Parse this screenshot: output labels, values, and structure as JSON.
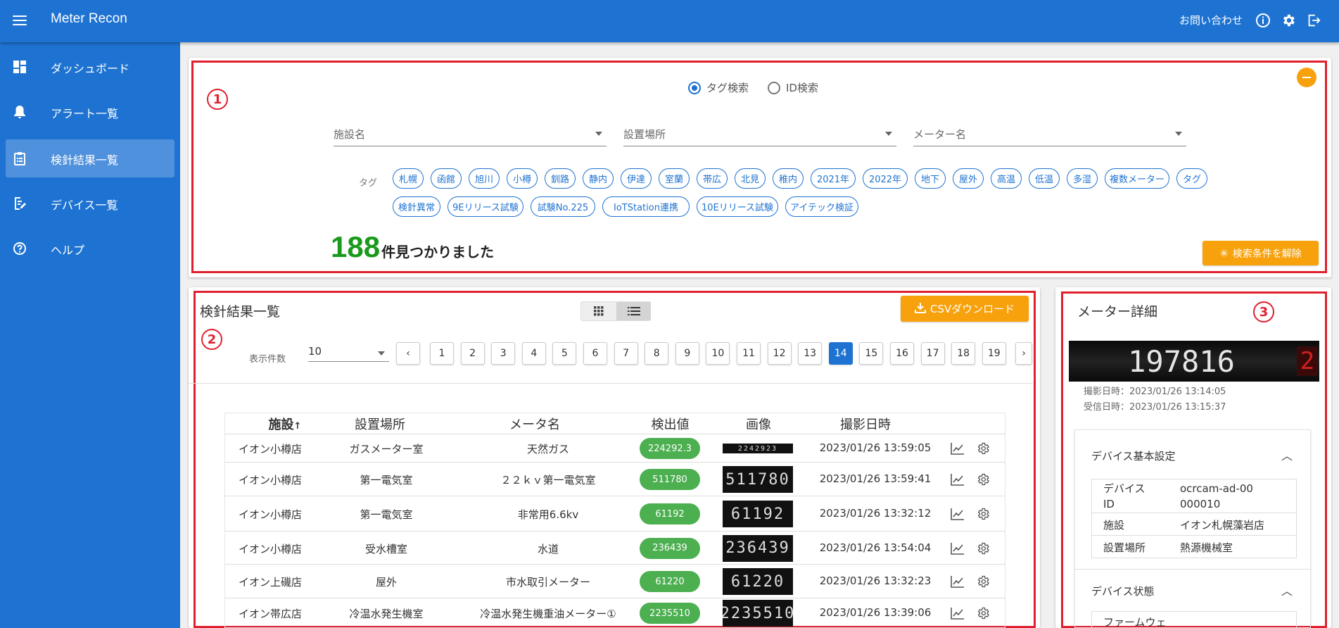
{
  "app": {
    "title": "Meter Recon",
    "contact": "お問い合わせ"
  },
  "sidebar": {
    "items": [
      {
        "label": "ダッシュボード",
        "icon": "dashboard-icon"
      },
      {
        "label": "アラート一覧",
        "icon": "bell-icon"
      },
      {
        "label": "検針結果一覧",
        "icon": "clipboard-icon",
        "active": true
      },
      {
        "label": "デバイス一覧",
        "icon": "edit-document-icon"
      },
      {
        "label": "ヘルプ",
        "icon": "help-icon"
      }
    ]
  },
  "annotations": {
    "one": "1",
    "two": "2",
    "three": "3"
  },
  "search": {
    "mode_tag": "タグ検索",
    "mode_id": "ID検索",
    "facility_placeholder": "施設名",
    "location_placeholder": "設置場所",
    "meter_placeholder": "メーター名",
    "tag_label": "タグ",
    "tags_row1": [
      "札幌",
      "函館",
      "旭川",
      "小樽",
      "釧路",
      "静内",
      "伊達",
      "室蘭",
      "帯広",
      "北見",
      "稚内",
      "2021年",
      "2022年",
      "地下",
      "屋外",
      "高温",
      "低温",
      "多湿",
      "複数メーター",
      "タグ"
    ],
    "tags_row2": [
      "検針異常",
      "9Eリリース試験",
      "試験No.225",
      "IoTStation連携",
      "10Eリリース試験",
      "アイテック検証"
    ],
    "count": "188",
    "count_suffix": "件見つかりました",
    "clear_button": "検索条件を解除"
  },
  "results": {
    "title": "検針結果一覧",
    "csv_button": "CSVダウンロード",
    "per_page_label": "表示件数",
    "per_page_value": "10",
    "pages": [
      "1",
      "2",
      "3",
      "4",
      "5",
      "6",
      "7",
      "8",
      "9",
      "10",
      "11",
      "12",
      "13",
      "14",
      "15",
      "16",
      "17",
      "18",
      "19"
    ],
    "current_page": "14",
    "headers": {
      "facility": "施設",
      "sort_arrow": "↑",
      "location": "設置場所",
      "meter": "メータ名",
      "value": "検出値",
      "image": "画像",
      "datetime": "撮影日時"
    },
    "rows": [
      {
        "facility": "イオン小樽店",
        "location": "ガスメーター室",
        "meter": "天然ガス",
        "value": "224292.3",
        "datetime": "2023/01/26 13:59:05"
      },
      {
        "facility": "イオン小樽店",
        "location": "第一電気室",
        "meter": "２２ｋｖ第一電気室",
        "value": "511780",
        "datetime": "2023/01/26 13:59:41"
      },
      {
        "facility": "イオン小樽店",
        "location": "第一電気室",
        "meter": "非常用6.6kv",
        "value": "61192",
        "datetime": "2023/01/26 13:32:12"
      },
      {
        "facility": "イオン小樽店",
        "location": "受水槽室",
        "meter": "水道",
        "value": "236439",
        "datetime": "2023/01/26 13:54:04"
      },
      {
        "facility": "イオン上磯店",
        "location": "屋外",
        "meter": "市水取引メーター",
        "value": "61220",
        "datetime": "2023/01/26 13:32:23"
      },
      {
        "facility": "イオン帯広店",
        "location": "冷温水発生機室",
        "meter": "冷温水発生機重油メーター①",
        "value": "2235510",
        "datetime": "2023/01/26 13:39:06"
      }
    ]
  },
  "detail": {
    "title": "メーター詳細",
    "image_digits": "197816",
    "image_digit_red": "2",
    "shot": "撮影日時：2023/01/26 13:14:05",
    "received": "受信日時：2023/01/26 13:15:37",
    "basic_title": "デバイス基本設定",
    "basic": [
      {
        "k": "デバイスID",
        "v": "ocrcam-ad-00000010"
      },
      {
        "k": "施設",
        "v": "イオン札幌藻岩店"
      },
      {
        "k": "設置場所",
        "v": "熱源機械室"
      }
    ],
    "status_title": "デバイス状態",
    "status_first": "ファームウェ"
  },
  "colors": {
    "primary": "#1e73d2",
    "accent": "#f7a10c",
    "annotation": "#e0202f",
    "count": "#1a9a1a",
    "pill": "#4caf50"
  }
}
